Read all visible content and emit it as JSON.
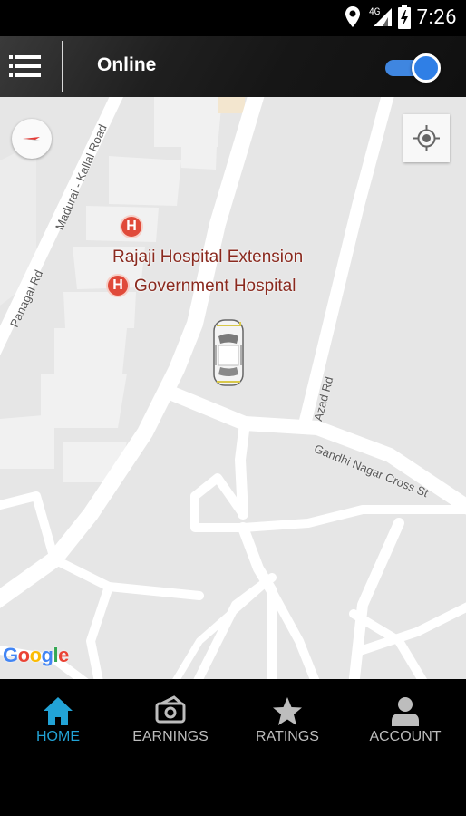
{
  "status_bar": {
    "time": "7:26",
    "network": "4G",
    "icons": [
      "location-icon",
      "signal-icon",
      "battery-charging-icon"
    ]
  },
  "app_bar": {
    "menu_icon": "hamburger-menu-icon",
    "status_label": "Online",
    "online_toggle": true,
    "toggle_color": "#2f7fe6"
  },
  "map": {
    "places": [
      {
        "name": "Rajaji Hospital Extension",
        "icon": "hospital-icon"
      },
      {
        "name": "Government Hospital",
        "icon": "hospital-icon"
      }
    ],
    "roads": [
      "Madurai - Kallal Road",
      "Panagal Rd",
      "Azad Rd",
      "Gandhi Nagar Cross St"
    ],
    "hospital_icon_letter": "H",
    "attribution": "Google",
    "vehicle": "car-icon"
  },
  "bottom_nav": {
    "active_color": "#22a3d6",
    "items": [
      {
        "label": "HOME",
        "icon": "home-icon",
        "active": true
      },
      {
        "label": "EARNINGS",
        "icon": "earnings-icon",
        "active": false
      },
      {
        "label": "RATINGS",
        "icon": "star-icon",
        "active": false
      },
      {
        "label": "ACCOUNT",
        "icon": "account-icon",
        "active": false
      }
    ]
  }
}
